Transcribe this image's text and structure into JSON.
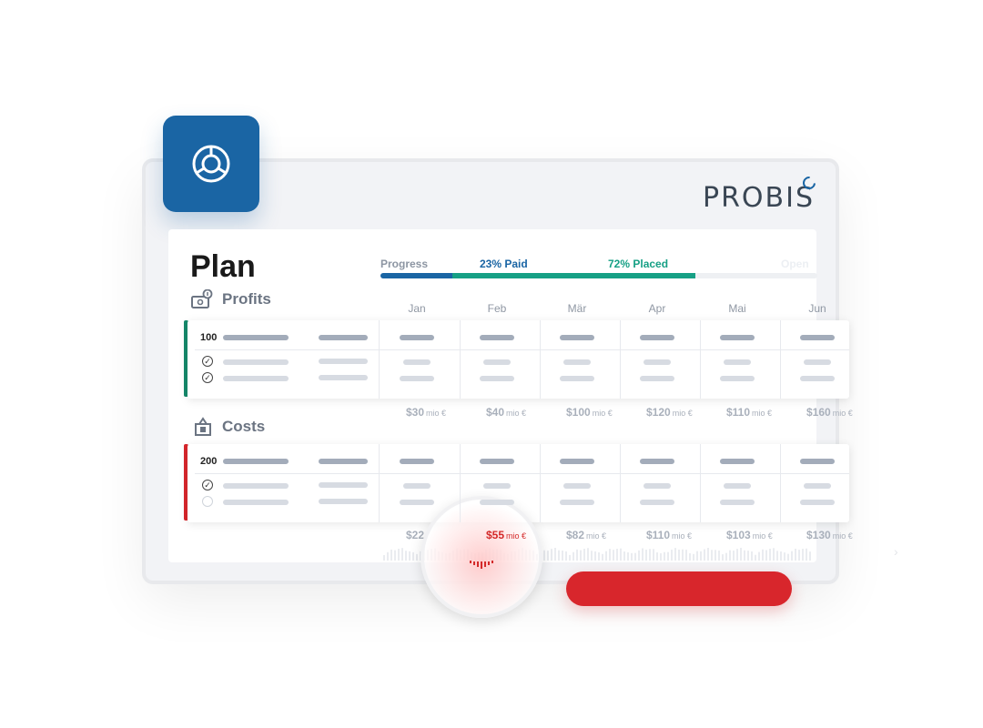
{
  "brand": {
    "name": "PROBIS",
    "accent": "#1a65a4"
  },
  "app_icon": "pie-chart-icon",
  "plan": {
    "title": "Plan"
  },
  "progress": {
    "label": "Progress",
    "paid_label": "23% Paid",
    "placed_label": "72% Placed",
    "open_label": "Open",
    "paid_fraction": 0.23,
    "placed_fraction": 0.72,
    "paid_color": "#1a65a4",
    "placed_color": "#16a085"
  },
  "months": [
    "Jan",
    "Feb",
    "Mär",
    "Apr",
    "Mai",
    "Jun"
  ],
  "profits": {
    "label": "Profits",
    "icon": "money-icon",
    "accent": "#15896b",
    "row_number": "100",
    "checks": [
      true,
      true
    ],
    "amounts": [
      {
        "value": "$30",
        "unit": "mio €"
      },
      {
        "value": "$40",
        "unit": "mio €"
      },
      {
        "value": "$100",
        "unit": "mio €"
      },
      {
        "value": "$120",
        "unit": "mio €"
      },
      {
        "value": "$110",
        "unit": "mio €"
      },
      {
        "value": "$160",
        "unit": "mio €"
      }
    ]
  },
  "costs": {
    "label": "Costs",
    "icon": "money-bag-icon",
    "accent": "#d8262c",
    "row_number": "200",
    "checks": [
      true,
      false
    ],
    "amounts": [
      {
        "value": "$22",
        "unit": ""
      },
      {
        "value": "$55",
        "unit": "mio €"
      },
      {
        "value": "$82",
        "unit": "mio €"
      },
      {
        "value": "$110",
        "unit": "mio €"
      },
      {
        "value": "$103",
        "unit": "mio €"
      },
      {
        "value": "$130",
        "unit": "mio €"
      }
    ]
  },
  "highlight": {
    "value": "$55",
    "unit": "mio €",
    "color": "#d42a2a"
  }
}
